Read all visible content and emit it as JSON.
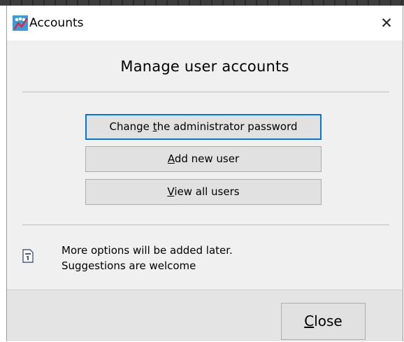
{
  "window": {
    "title": "Accounts",
    "close_glyph": "✕",
    "app_icon": "accounts-app-icon"
  },
  "main": {
    "heading": "Manage user accounts",
    "buttons": [
      {
        "mnemonic_pre": "Change ",
        "mnemonic_key": "t",
        "mnemonic_post": "he administrator password",
        "label": "Change the administrator password",
        "default": true
      },
      {
        "mnemonic_pre": "",
        "mnemonic_key": "A",
        "mnemonic_post": "dd new user",
        "label": "Add new user",
        "default": false
      },
      {
        "mnemonic_pre": "",
        "mnemonic_key": "V",
        "mnemonic_post": "iew all users",
        "label": "View all users",
        "default": false
      }
    ]
  },
  "info": {
    "icon": "info-document-icon",
    "line1": "More options will be added later.",
    "line2": "Suggestions are welcome"
  },
  "footer": {
    "close_pre": "",
    "close_key": "C",
    "close_post": "lose",
    "close_label": "Close"
  },
  "colors": {
    "accent": "#0078d7",
    "dialog_bg": "#f0f0f0",
    "button_bg": "#e1e1e1"
  }
}
